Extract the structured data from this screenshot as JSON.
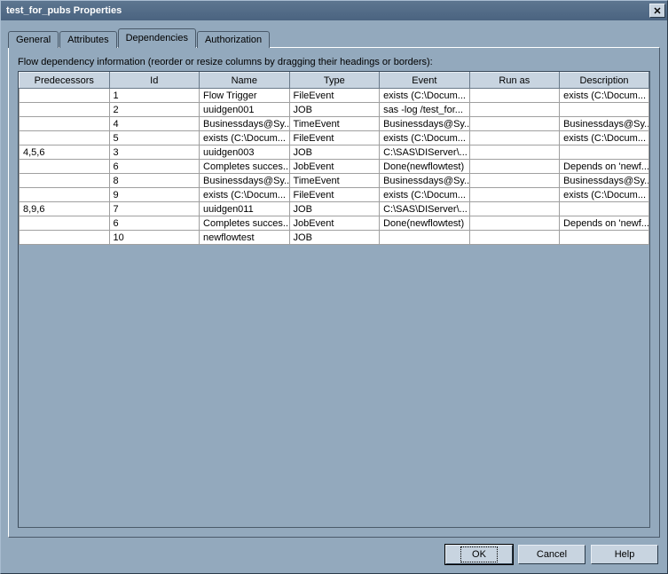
{
  "title": "test_for_pubs Properties",
  "tabs": {
    "general": "General",
    "attributes": "Attributes",
    "dependencies": "Dependencies",
    "authorization": "Authorization"
  },
  "description": "Flow dependency information (reorder or resize columns by dragging their headings or borders):",
  "columns": [
    "Predecessors",
    "Id",
    "Name",
    "Type",
    "Event",
    "Run as",
    "Description"
  ],
  "rows": [
    {
      "pred": "",
      "id": "1",
      "name": "Flow Trigger",
      "type": "FileEvent",
      "event": "exists (C:\\Docum...",
      "run": "",
      "desc": "exists (C:\\Docum..."
    },
    {
      "pred": "",
      "id": "2",
      "name": "uuidgen001",
      "type": "JOB",
      "event": "sas -log /test_for...",
      "run": "",
      "desc": ""
    },
    {
      "pred": "",
      "id": "4",
      "name": "Businessdays@Sy...",
      "type": "TimeEvent",
      "event": "Businessdays@Sy...",
      "run": "",
      "desc": "Businessdays@Sy..."
    },
    {
      "pred": "",
      "id": "5",
      "name": "exists (C:\\Docum...",
      "type": "FileEvent",
      "event": "exists (C:\\Docum...",
      "run": "",
      "desc": "exists (C:\\Docum..."
    },
    {
      "pred": "4,5,6",
      "id": "3",
      "name": "uuidgen003",
      "type": "JOB",
      "event": "C:\\SAS\\DIServer\\...",
      "run": "",
      "desc": ""
    },
    {
      "pred": "",
      "id": "6",
      "name": "Completes succes...",
      "type": "JobEvent",
      "event": "Done(newflowtest)",
      "run": "",
      "desc": "Depends on 'newf..."
    },
    {
      "pred": "",
      "id": "8",
      "name": "Businessdays@Sy...",
      "type": "TimeEvent",
      "event": "Businessdays@Sy...",
      "run": "",
      "desc": "Businessdays@Sy..."
    },
    {
      "pred": "",
      "id": "9",
      "name": "exists (C:\\Docum...",
      "type": "FileEvent",
      "event": "exists (C:\\Docum...",
      "run": "",
      "desc": "exists (C:\\Docum..."
    },
    {
      "pred": "8,9,6",
      "id": "7",
      "name": "uuidgen011",
      "type": "JOB",
      "event": "C:\\SAS\\DIServer\\...",
      "run": "",
      "desc": ""
    },
    {
      "pred": "",
      "id": "6",
      "name": "Completes succes...",
      "type": "JobEvent",
      "event": "Done(newflowtest)",
      "run": "",
      "desc": "Depends on 'newf..."
    },
    {
      "pred": "",
      "id": "10",
      "name": "newflowtest",
      "type": "JOB",
      "event": "",
      "run": "",
      "desc": ""
    }
  ],
  "buttons": {
    "ok": "OK",
    "cancel": "Cancel",
    "help": "Help"
  }
}
